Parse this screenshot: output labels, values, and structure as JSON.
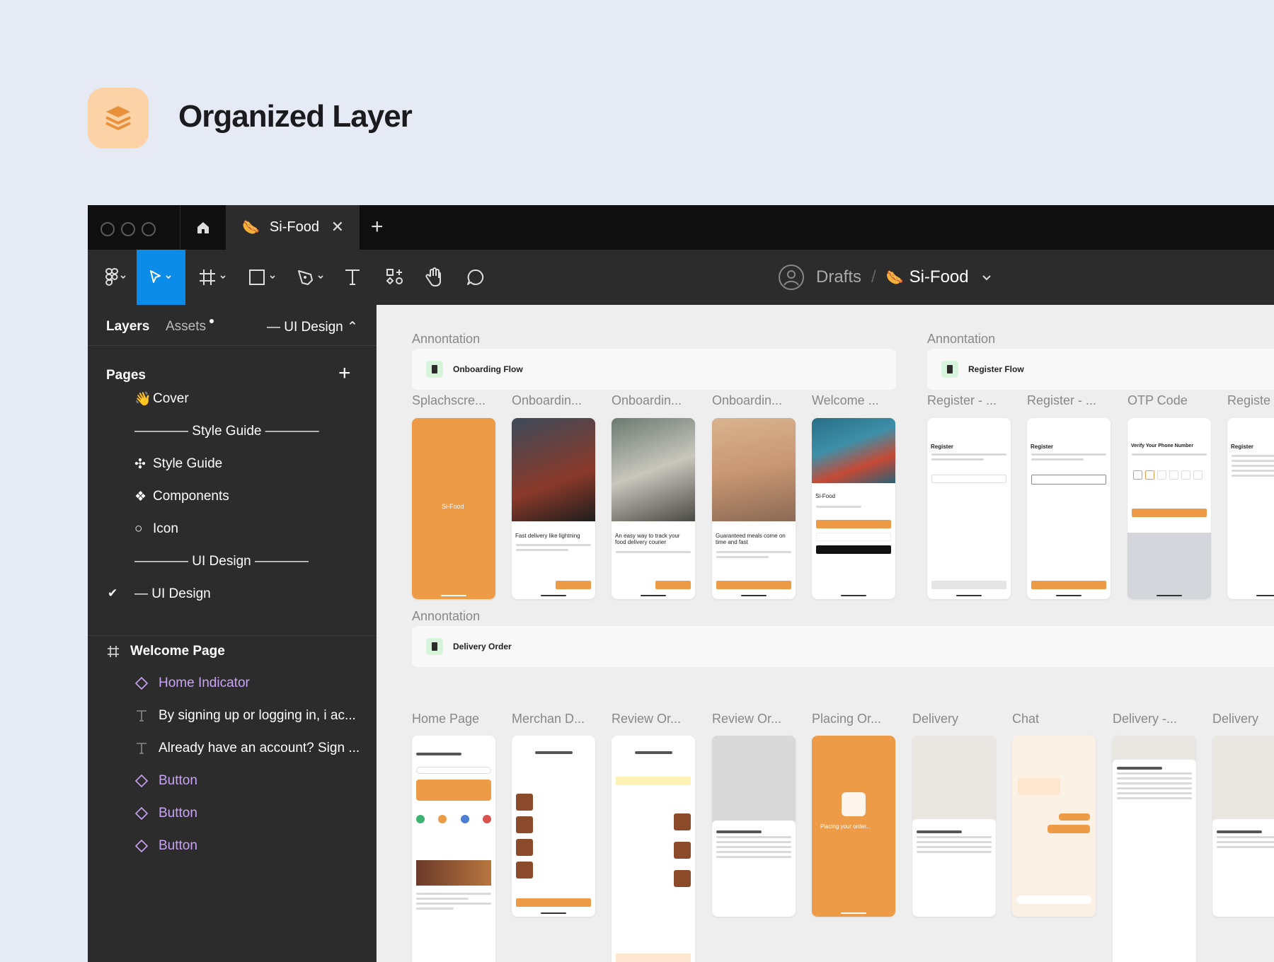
{
  "hero": {
    "title": "Organized Layer",
    "icon": "layers-icon"
  },
  "tabs": {
    "file_name": "Si-Food",
    "close": "✕",
    "add": "+"
  },
  "breadcrumb": {
    "drafts": "Drafts",
    "separator": "/",
    "file": "Si-Food"
  },
  "sidebar": {
    "tab_layers": "Layers",
    "tab_assets": "Assets",
    "current_page": "— UI Design ⌃",
    "pages_title": "Pages",
    "add": "+",
    "pages": [
      {
        "emoji": "👋",
        "label": "Cover"
      },
      {
        "emoji": "",
        "label": "———— Style Guide ————"
      },
      {
        "emoji": "✣",
        "label": "Style Guide"
      },
      {
        "emoji": "❖",
        "label": "Components"
      },
      {
        "emoji": "○",
        "label": "Icon"
      },
      {
        "emoji": "",
        "label": "———— UI Design ————"
      },
      {
        "emoji": "",
        "label": "— UI Design"
      }
    ],
    "frame": "Welcome Page",
    "layers": [
      {
        "type": "component",
        "label": "Home Indicator"
      },
      {
        "type": "text",
        "label": "By signing up or logging in, i ac..."
      },
      {
        "type": "text",
        "label": "Already have an account? Sign ..."
      },
      {
        "type": "component",
        "label": "Button"
      },
      {
        "type": "component",
        "label": "Button"
      },
      {
        "type": "component",
        "label": "Button"
      }
    ]
  },
  "canvas": {
    "sections": [
      {
        "label": "Annontation",
        "title": "Onboarding Flow"
      },
      {
        "label": "Annontation",
        "title": "Register Flow"
      },
      {
        "label": "Annontation",
        "title": "Delivery Order"
      }
    ],
    "row1": [
      "Splachscre...",
      "Onboardin...",
      "Onboardin...",
      "Onboardin...",
      "Welcome ...",
      "Register - ...",
      "Register - ...",
      "OTP Code",
      "Registe"
    ],
    "row2": [
      "Home Page",
      "Merchan D...",
      "Review Or...",
      "Review Or...",
      "Placing Or...",
      "Delivery",
      "Chat",
      "Delivery -...",
      "Delivery"
    ],
    "splash_text": "Si-Food",
    "onboard_1": "Fast delivery like lightning",
    "onboard_2": "An easy way to track your food delivery courier",
    "onboard_3": "Guaranteed meals come on time and fast",
    "welcome_title": "Si-Food",
    "register_title": "Register",
    "otp_title": "Verify Your Phone Number",
    "placing_text": "Placing your order..."
  },
  "colors": {
    "accent": "#0c8ce9",
    "brand_orange": "#ee9b48",
    "component_purple": "#c9a4f5"
  }
}
